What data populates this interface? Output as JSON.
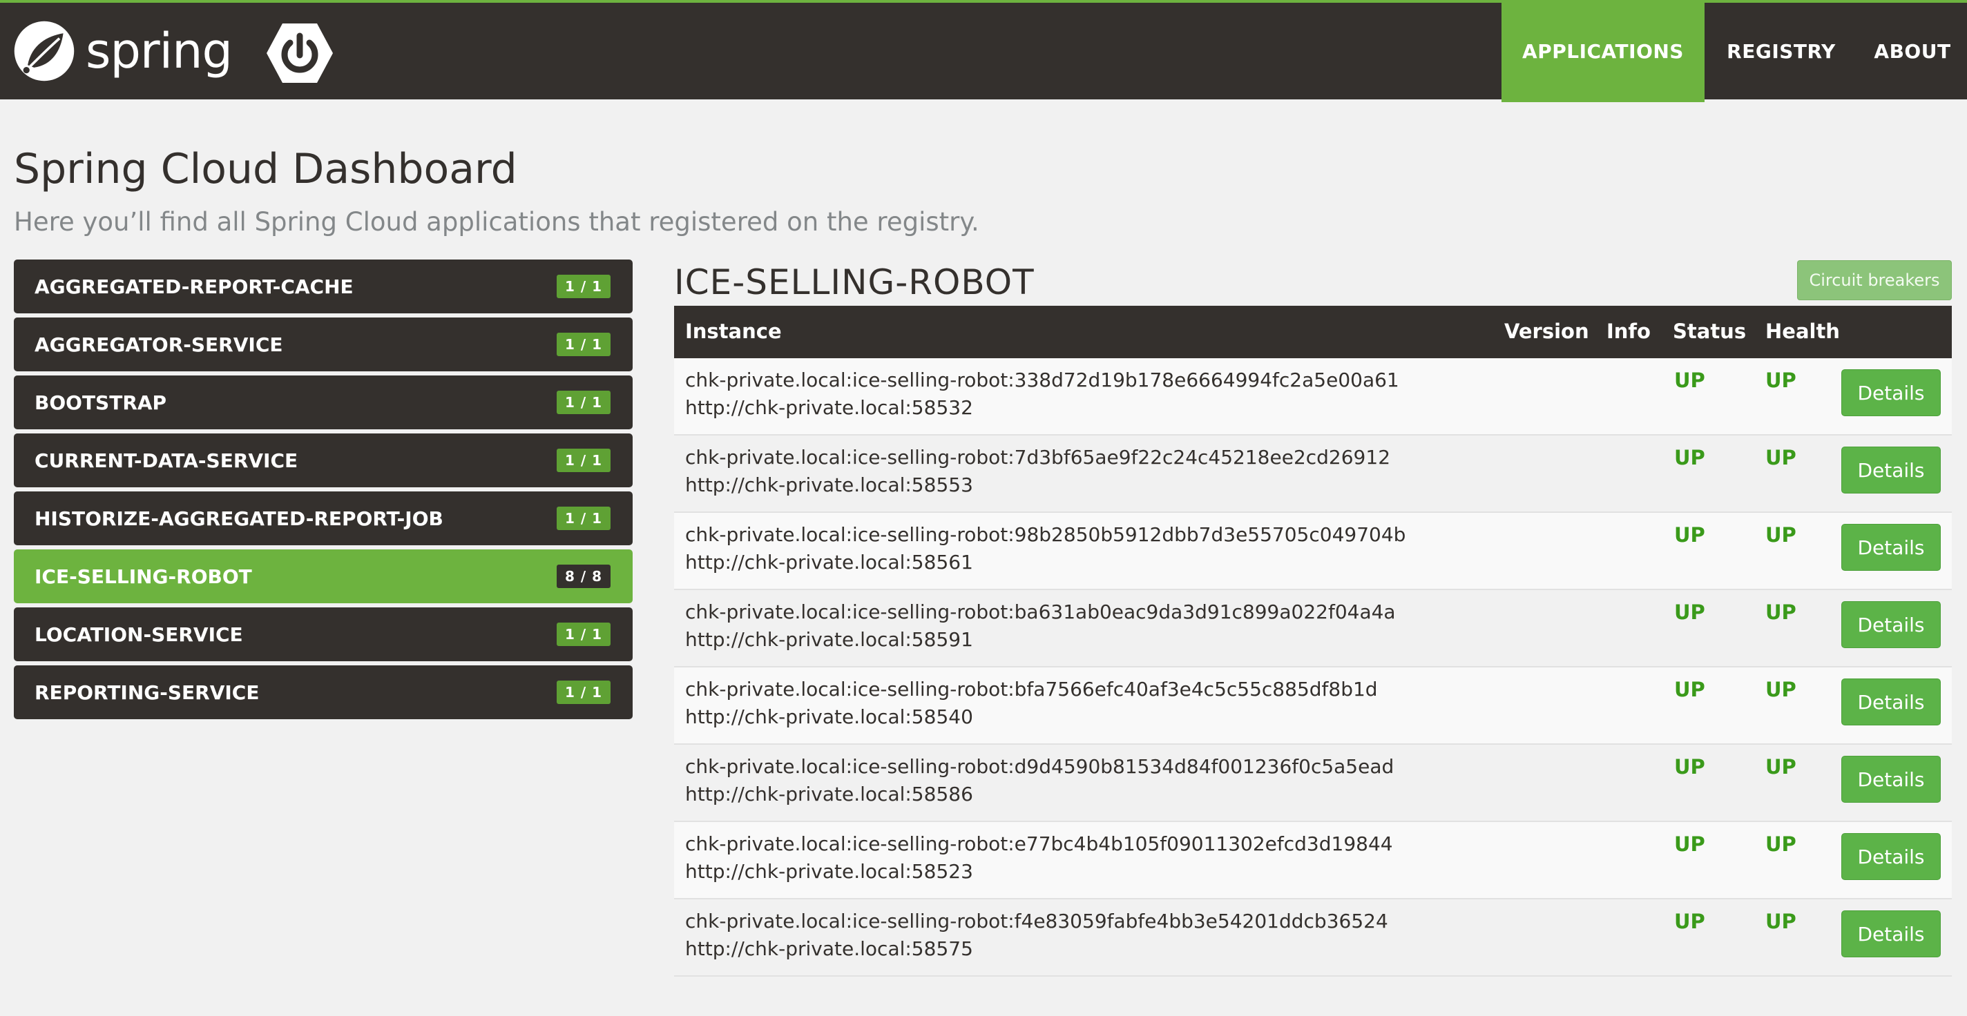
{
  "navbar": {
    "brand_text": "spring",
    "items": [
      {
        "label": "APPLICATIONS"
      },
      {
        "label": "REGISTRY"
      },
      {
        "label": "ABOUT"
      }
    ]
  },
  "header": {
    "title": "Spring Cloud Dashboard",
    "subtitle": "Here you’ll find all Spring Cloud applications that registered on the registry."
  },
  "sidebar": {
    "apps": [
      {
        "name": "AGGREGATED-REPORT-CACHE",
        "count": "1 / 1"
      },
      {
        "name": "AGGREGATOR-SERVICE",
        "count": "1 / 1"
      },
      {
        "name": "BOOTSTRAP",
        "count": "1 / 1"
      },
      {
        "name": "CURRENT-DATA-SERVICE",
        "count": "1 / 1"
      },
      {
        "name": "HISTORIZE-AGGREGATED-REPORT-JOB",
        "count": "1 / 1"
      },
      {
        "name": "ICE-SELLING-ROBOT",
        "count": "8 / 8",
        "active": true
      },
      {
        "name": "LOCATION-SERVICE",
        "count": "1 / 1"
      },
      {
        "name": "REPORTING-SERVICE",
        "count": "1 / 1"
      }
    ]
  },
  "main": {
    "app_title": "ICE-SELLING-ROBOT",
    "circuit_breakers_label": "Circuit breakers",
    "columns": {
      "instance": "Instance",
      "version": "Version",
      "info": "Info",
      "status": "Status",
      "health": "Health"
    },
    "details_label": "Details",
    "instances": [
      {
        "id": "chk-private.local:ice-selling-robot:338d72d19b178e6664994fc2a5e00a61",
        "url": "http://chk-private.local:58532",
        "status": "UP",
        "health": "UP"
      },
      {
        "id": "chk-private.local:ice-selling-robot:7d3bf65ae9f22c24c45218ee2cd26912",
        "url": "http://chk-private.local:58553",
        "status": "UP",
        "health": "UP"
      },
      {
        "id": "chk-private.local:ice-selling-robot:98b2850b5912dbb7d3e55705c049704b",
        "url": "http://chk-private.local:58561",
        "status": "UP",
        "health": "UP"
      },
      {
        "id": "chk-private.local:ice-selling-robot:ba631ab0eac9da3d91c899a022f04a4a",
        "url": "http://chk-private.local:58591",
        "status": "UP",
        "health": "UP"
      },
      {
        "id": "chk-private.local:ice-selling-robot:bfa7566efc40af3e4c5c55c885df8b1d",
        "url": "http://chk-private.local:58540",
        "status": "UP",
        "health": "UP"
      },
      {
        "id": "chk-private.local:ice-selling-robot:d9d4590b81534d84f001236f0c5a5ead",
        "url": "http://chk-private.local:58586",
        "status": "UP",
        "health": "UP"
      },
      {
        "id": "chk-private.local:ice-selling-robot:e77bc4b4b105f09011302efcd3d19844",
        "url": "http://chk-private.local:58523",
        "status": "UP",
        "health": "UP"
      },
      {
        "id": "chk-private.local:ice-selling-robot:f4e83059fabfe4bb3e54201ddcb36524",
        "url": "http://chk-private.local:58575",
        "status": "UP",
        "health": "UP"
      }
    ]
  },
  "colors": {
    "accent": "#6db33f",
    "navbar": "#34302d",
    "status_up": "#3a9a1a"
  }
}
